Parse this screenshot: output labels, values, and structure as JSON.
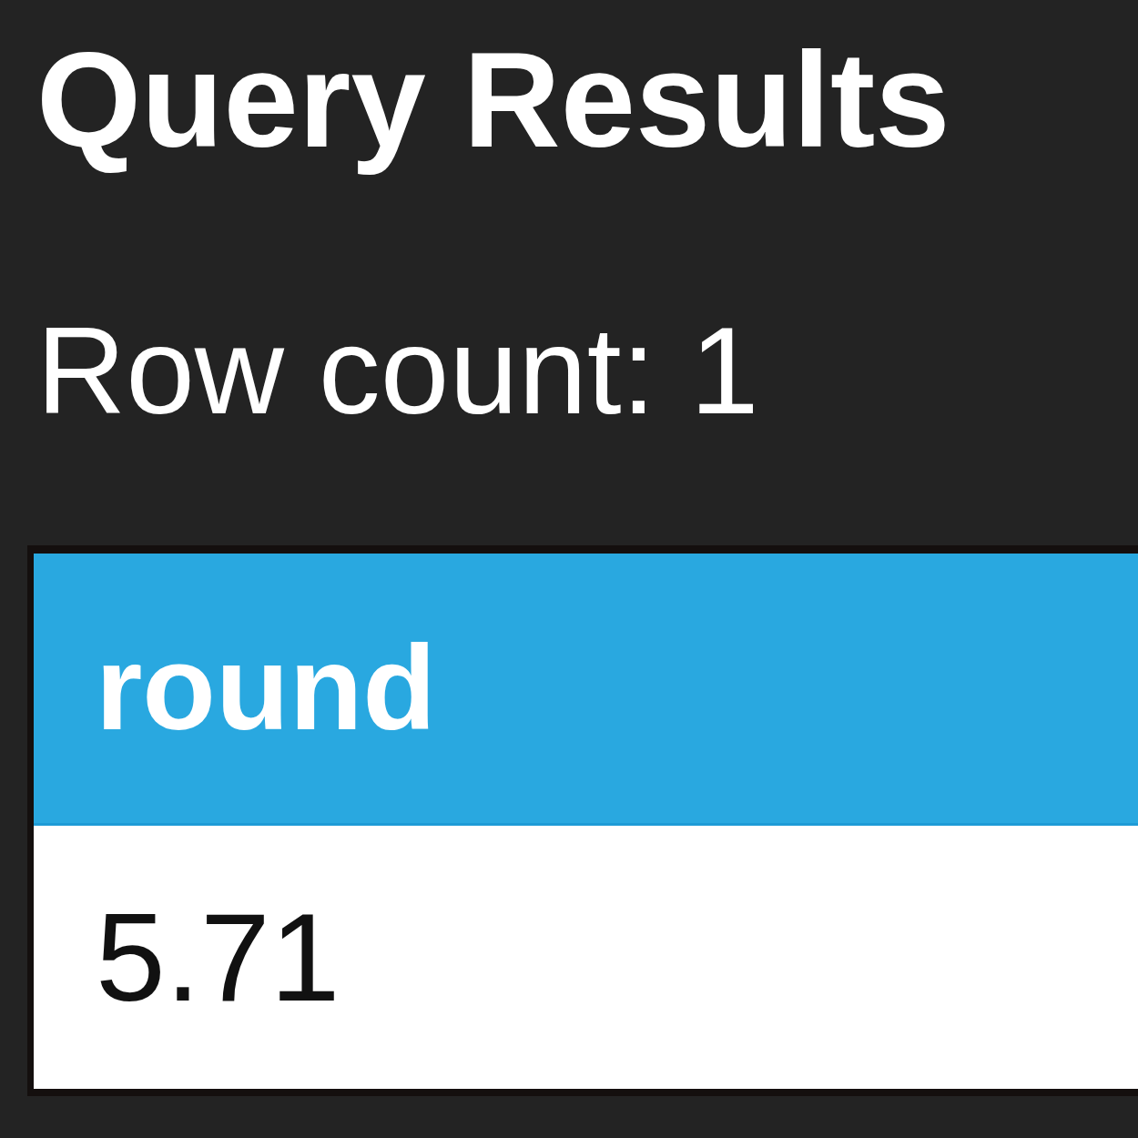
{
  "title": "Query Results",
  "row_count": "Row count: 1",
  "table": {
    "columns": [
      "round"
    ],
    "rows": [
      [
        "5.71"
      ]
    ]
  }
}
